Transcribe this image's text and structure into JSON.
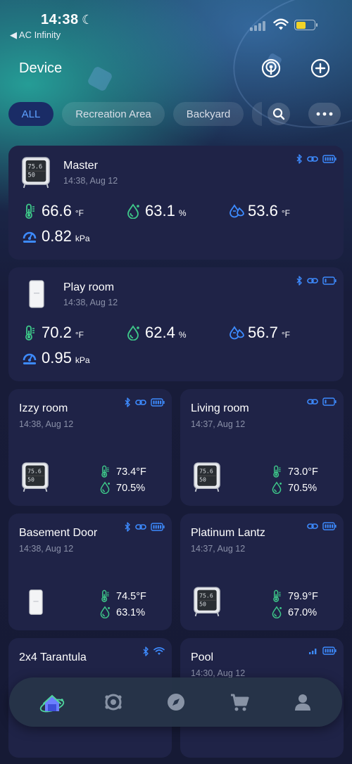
{
  "status_bar": {
    "time": "14:38",
    "back_app": "◀ AC Infinity"
  },
  "header": {
    "title": "Device"
  },
  "filters": {
    "items": [
      "ALL",
      "Recreation Area",
      "Backyard"
    ],
    "active": "ALL"
  },
  "devices": [
    {
      "name": "Master",
      "timestamp": "14:38,  Aug 12",
      "temp": "66.6",
      "temp_unit": "°F",
      "humidity": "63.1",
      "humidity_unit": "%",
      "dew": "53.6",
      "dew_unit": "°F",
      "vpd": "0.82",
      "vpd_unit": "kPa"
    },
    {
      "name": "Play room",
      "timestamp": "14:38,  Aug 12",
      "temp": "70.2",
      "temp_unit": "°F",
      "humidity": "62.4",
      "humidity_unit": "%",
      "dew": "56.7",
      "dew_unit": "°F",
      "vpd": "0.95",
      "vpd_unit": "kPa"
    },
    {
      "name": "Izzy room",
      "timestamp": "14:38,  Aug 12",
      "temp": "73.4°F",
      "humidity": "70.5%"
    },
    {
      "name": "Living room",
      "timestamp": "14:37,  Aug 12",
      "temp": "73.0°F",
      "humidity": "70.5%"
    },
    {
      "name": "Basement Door",
      "timestamp": "14:38,  Aug 12",
      "temp": "74.5°F",
      "humidity": "63.1%"
    },
    {
      "name": "Platinum Lantz",
      "timestamp": "14:37,  Aug 12",
      "temp": "79.9°F",
      "humidity": "67.0%"
    },
    {
      "name": "2x4 Tarantula",
      "timestamp": ""
    },
    {
      "name": "Pool",
      "timestamp": "14:30,  Aug 12"
    }
  ],
  "colors": {
    "accent": "#3d8bff",
    "temp_icon": "#3ec98a",
    "card_bg": "#1f2347"
  },
  "nav": {
    "items": [
      "home-icon",
      "devices-icon",
      "explore-icon",
      "shop-icon",
      "profile-icon"
    ],
    "active": "home-icon"
  }
}
